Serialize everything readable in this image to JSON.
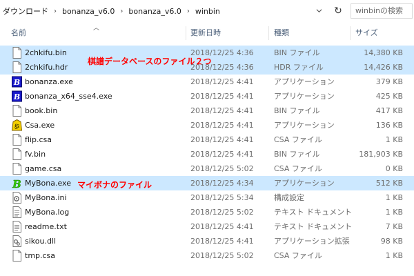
{
  "breadcrumb": {
    "items": [
      "ダウンロード",
      "bonanza_v6.0",
      "bonanza_v6.0",
      "winbin"
    ],
    "separator": "›"
  },
  "search": {
    "placeholder": "winbinの検索"
  },
  "columns": {
    "name": "名前",
    "date": "更新日時",
    "type": "種類",
    "size": "サイズ"
  },
  "files": [
    {
      "name": "2chkifu.bin",
      "date": "2018/12/25 4:36",
      "type": "BIN ファイル",
      "size": "14,380 KB",
      "icon": "blank-file-icon",
      "selected": true
    },
    {
      "name": "2chkifu.hdr",
      "date": "2018/12/25 4:36",
      "type": "HDR ファイル",
      "size": "14,426 KB",
      "icon": "blank-file-icon",
      "selected": true
    },
    {
      "name": "bonanza.exe",
      "date": "2018/12/25 4:41",
      "type": "アプリケーション",
      "size": "379 KB",
      "icon": "bonanza-app-icon",
      "selected": false
    },
    {
      "name": "bonanza_x64_sse4.exe",
      "date": "2018/12/25 4:41",
      "type": "アプリケーション",
      "size": "425 KB",
      "icon": "bonanza-app-icon",
      "selected": false
    },
    {
      "name": "book.bin",
      "date": "2018/12/25 4:41",
      "type": "BIN ファイル",
      "size": "417 KB",
      "icon": "blank-file-icon",
      "selected": false
    },
    {
      "name": "Csa.exe",
      "date": "2018/12/25 4:41",
      "type": "アプリケーション",
      "size": "136 KB",
      "icon": "shogi-piece-app-icon",
      "selected": false
    },
    {
      "name": "flip.csa",
      "date": "2018/12/25 4:41",
      "type": "CSA ファイル",
      "size": "1 KB",
      "icon": "blank-file-icon",
      "selected": false
    },
    {
      "name": "fv.bin",
      "date": "2018/12/25 4:41",
      "type": "BIN ファイル",
      "size": "181,903 KB",
      "icon": "blank-file-icon",
      "selected": false
    },
    {
      "name": "game.csa",
      "date": "2018/12/25 5:02",
      "type": "CSA ファイル",
      "size": "0 KB",
      "icon": "blank-file-icon",
      "selected": false
    },
    {
      "name": "MyBona.exe",
      "date": "2018/12/25 4:34",
      "type": "アプリケーション",
      "size": "512 KB",
      "icon": "mybona-app-icon",
      "selected": true
    },
    {
      "name": "MyBona.ini",
      "date": "2018/12/25 5:34",
      "type": "構成設定",
      "size": "1 KB",
      "icon": "settings-file-icon",
      "selected": false
    },
    {
      "name": "MyBona.log",
      "date": "2018/12/25 5:02",
      "type": "テキスト ドキュメント",
      "size": "1 KB",
      "icon": "text-file-icon",
      "selected": false
    },
    {
      "name": "readme.txt",
      "date": "2018/12/25 4:41",
      "type": "テキスト ドキュメント",
      "size": "7 KB",
      "icon": "text-file-icon",
      "selected": false
    },
    {
      "name": "sikou.dll",
      "date": "2018/12/25 4:41",
      "type": "アプリケーション拡張",
      "size": "98 KB",
      "icon": "dll-file-icon",
      "selected": false
    },
    {
      "name": "tmp.csa",
      "date": "2018/12/25 5:02",
      "type": "CSA ファイル",
      "size": "1 KB",
      "icon": "blank-file-icon",
      "selected": false
    }
  ],
  "annotations": {
    "book_note": "棋譜データベースのファイル２つ",
    "mybona_note": "マイボナのファイル"
  },
  "colors": {
    "selection": "#cce8ff",
    "annotation": "#ff0000",
    "header_text": "#4c607a"
  }
}
